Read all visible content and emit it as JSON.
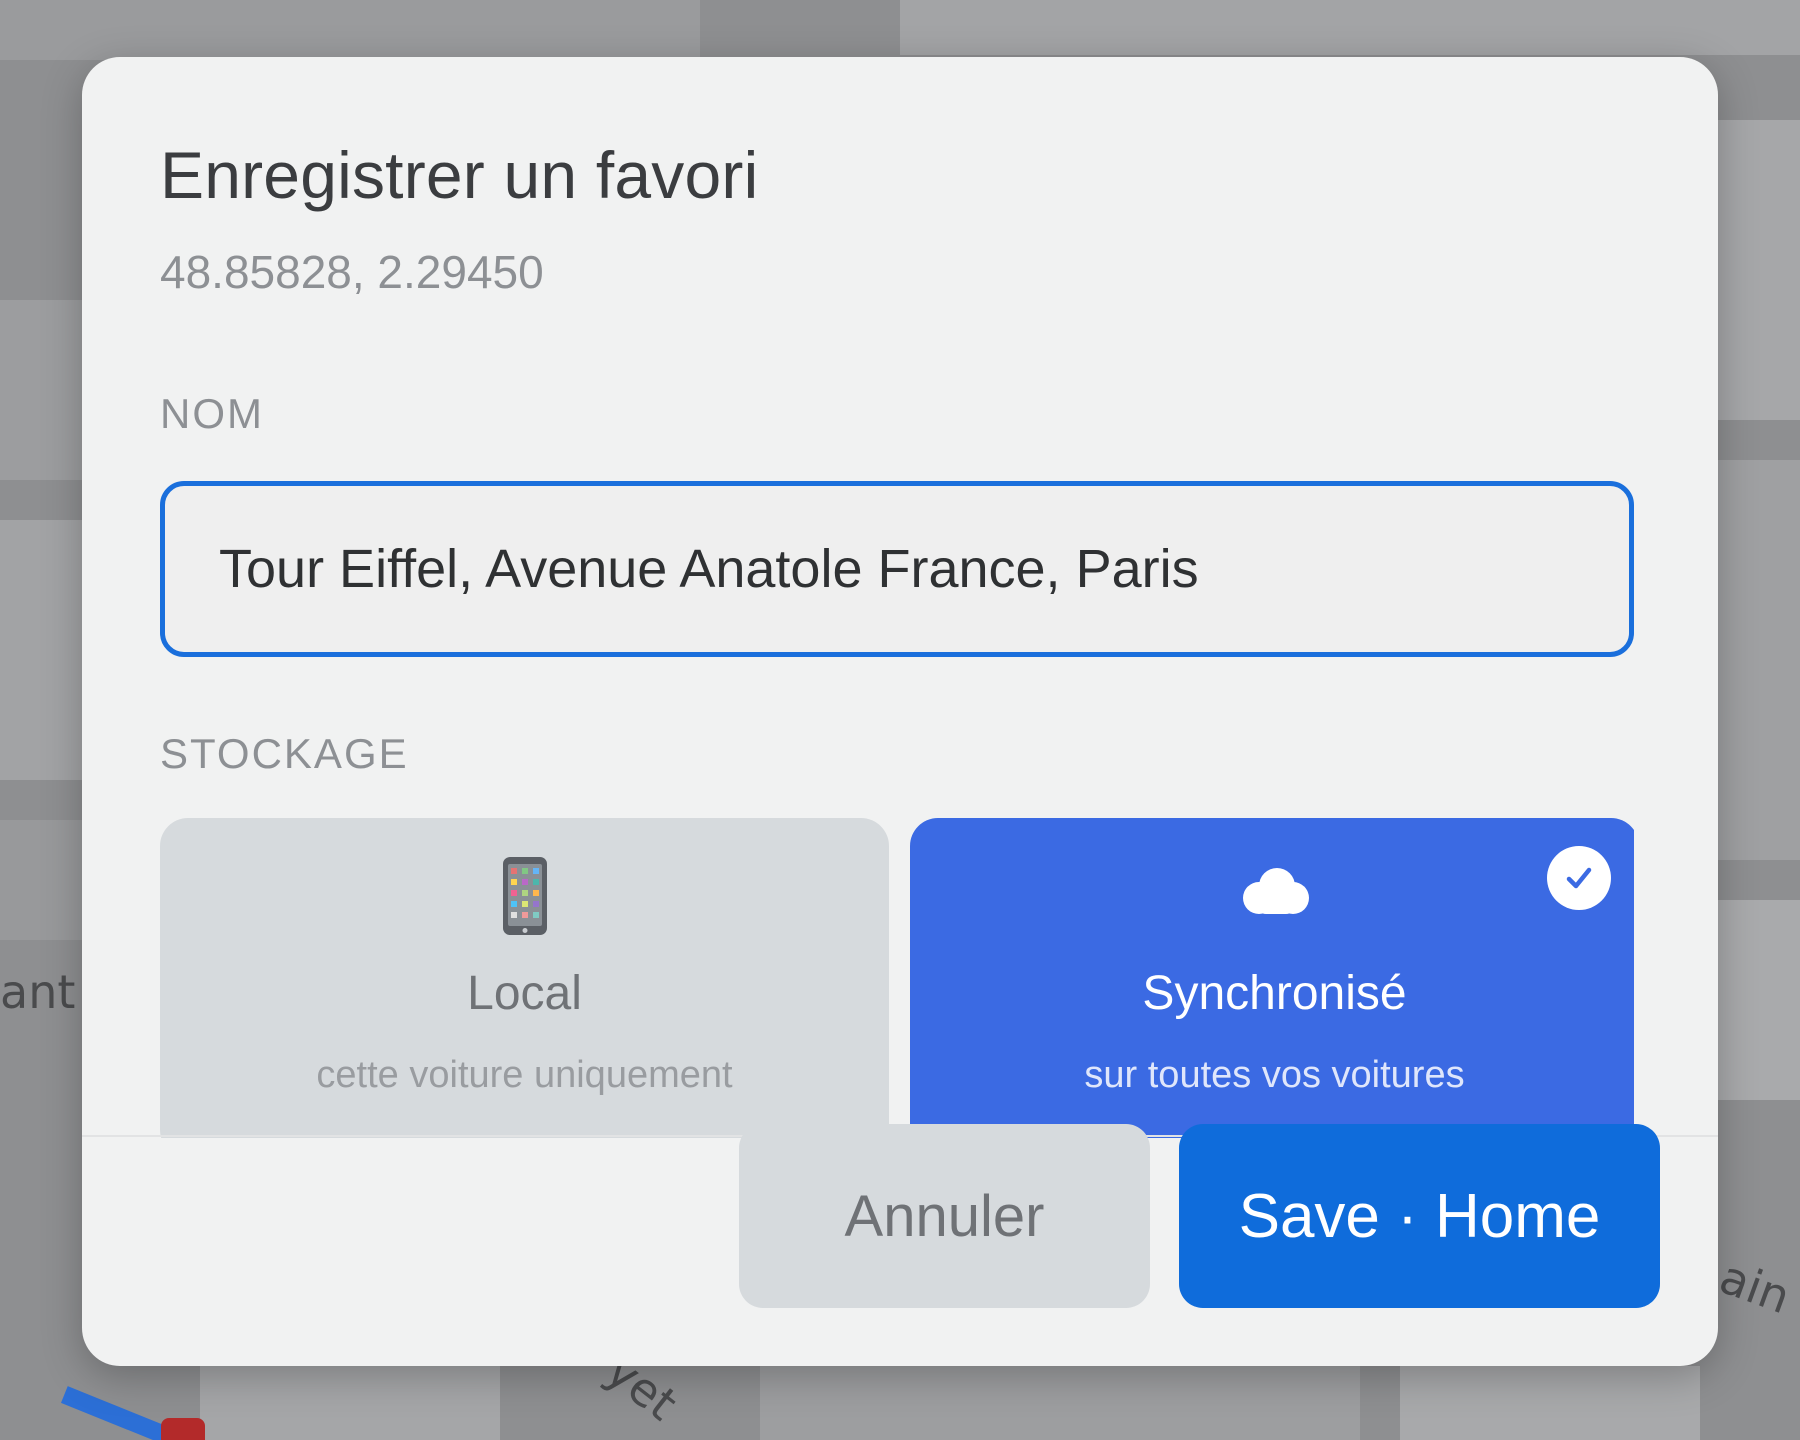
{
  "map": {
    "labels": {
      "left": "ant",
      "bottom": "yet",
      "right": "ain"
    },
    "route_color": "#2c6fd6",
    "marker_color": "#b32a2a"
  },
  "dialog": {
    "title": "Enregistrer un favori",
    "coordinates": "48.85828, 2.29450",
    "name_section": {
      "label": "NOM",
      "value": "Tour Eiffel, Avenue Anatole France, Paris"
    },
    "storage_section": {
      "label": "STOCKAGE",
      "options": [
        {
          "icon": "mobile-phone-icon",
          "title": "Local",
          "subtitle": "cette voiture uniquement",
          "selected": false
        },
        {
          "icon": "cloud-icon",
          "title": "Synchronisé",
          "subtitle": "sur toutes vos voitures",
          "selected": true
        }
      ]
    },
    "actions": {
      "cancel_label": "Annuler",
      "save_label": "Save · Home"
    },
    "colors": {
      "accent": "#0f6cdb",
      "selected_card": "#3b6ae3",
      "input_border": "#1a6fdc"
    }
  }
}
